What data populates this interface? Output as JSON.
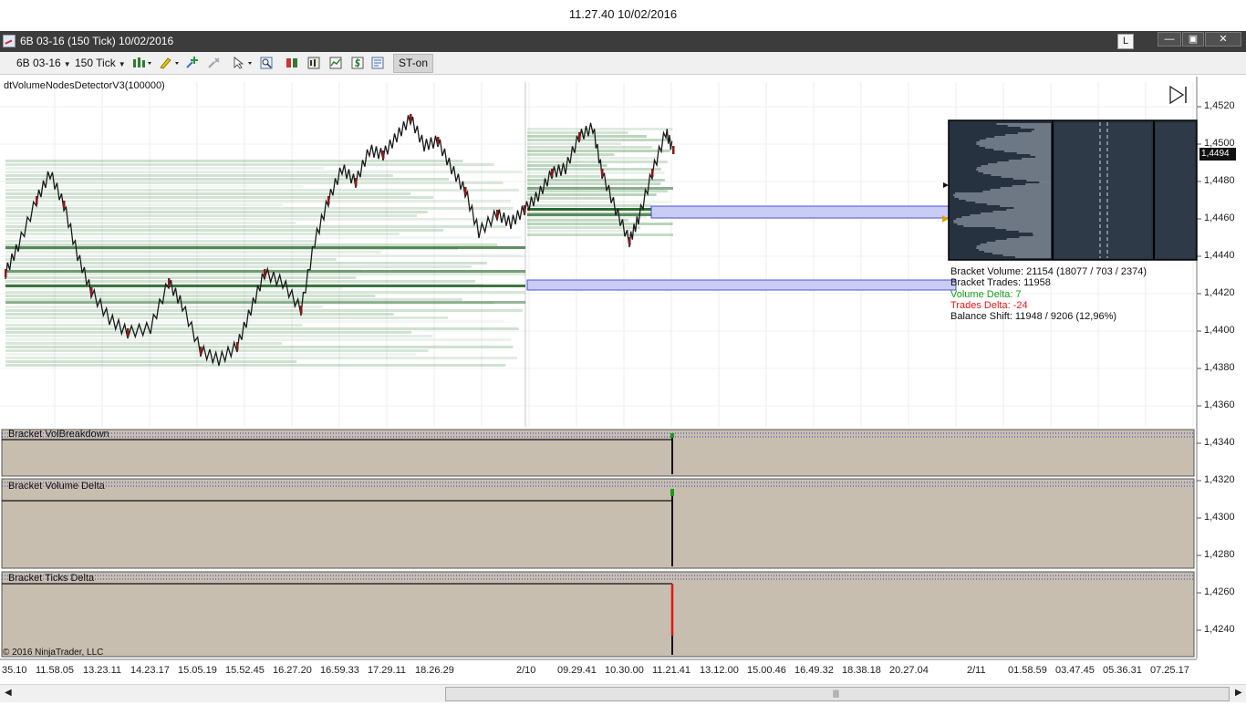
{
  "timestamp": "11.27.40 10/02/2016",
  "window": {
    "title": "6B 03-16 (150 Tick)  10/02/2016",
    "l_button": "L",
    "minimize": "—",
    "restore": "▣",
    "close": "✕"
  },
  "toolbar": {
    "instrument": "6B 03-16",
    "interval": "150 Tick",
    "st_label": "ST-on"
  },
  "chart": {
    "indicator": "dtVolumeNodesDetectorV3(100000)",
    "last_price": "1,4494",
    "price_labels": [
      "1,4520",
      "1,4500",
      "1,4480",
      "1,4460",
      "1,4440",
      "1,4420",
      "1,4400",
      "1,4380",
      "1,4360",
      "1,4340",
      "1,4320",
      "1,4300",
      "1,4280",
      "1,4260",
      "1,4240"
    ],
    "x_labels": [
      "35.10",
      "11.58.05",
      "13.23.11",
      "14.23.17",
      "15.05.19",
      "15.52.45",
      "16.27.20",
      "16.59.33",
      "17.29.11",
      "18.26.29",
      "2/10",
      "09.29.41",
      "10.30.00",
      "11.21.41",
      "13.12.00",
      "15.00.46",
      "16.49.32",
      "18.38.18",
      "20.27.04",
      "2/11",
      "01.58.59",
      "03.47.45",
      "05.36.31",
      "07.25.17"
    ],
    "colors": {
      "panel_bg": "#c8beb0",
      "node_green": "#2e7d32",
      "zone_fill": "#c9cdf6",
      "zone_border": "#2a32c8",
      "profile_bg": "#263240"
    }
  },
  "stats": {
    "bracket_volume": "Bracket Volume: 21154 (18077 / 703 / 2374)",
    "bracket_trades": "Bracket Trades: 11958",
    "volume_delta": "Volume Delta: 7",
    "trades_delta": "Trades Delta: -24",
    "balance_shift": "Balance Shift: 11948 / 9206 (12,96%)"
  },
  "panels": {
    "vol_breakdown": "Bracket VolBreakdown",
    "volume_delta": "Bracket Volume Delta",
    "ticks_delta": "Bracket Ticks Delta"
  },
  "copyright": "© 2016 NinjaTrader, LLC"
}
